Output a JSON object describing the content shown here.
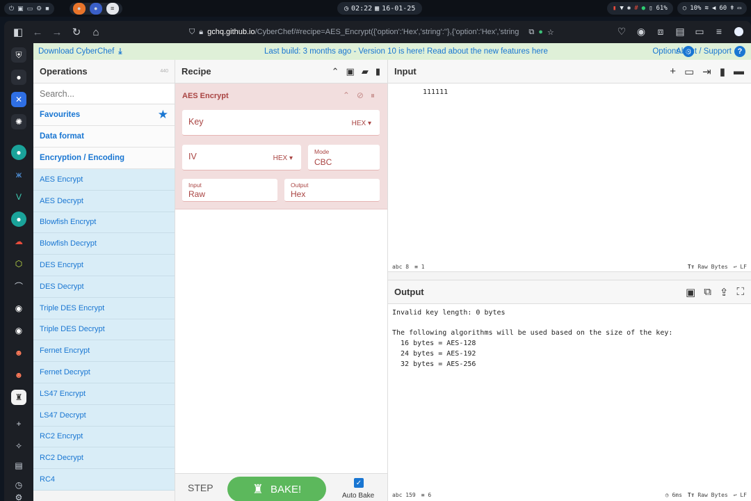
{
  "os": {
    "clock": "02:22",
    "date": "16-01-25",
    "battery": "61%",
    "cpu": "10%",
    "volume": "60"
  },
  "browser": {
    "url_host": "gchq.github.io",
    "url_path": "/CyberChef/#recipe=AES_Encrypt({'option':'Hex','string':''},{'option':'Hex','string"
  },
  "banner": {
    "download": "Download CyberChef",
    "news": "Last build: 3 months ago - Version 10 is here! Read about the new features here",
    "options": "Options",
    "about": "About / Support"
  },
  "operations": {
    "title": "Operations",
    "count": "440",
    "search_placeholder": "Search...",
    "categories": [
      "Favourites",
      "Data format",
      "Encryption / Encoding"
    ],
    "items": [
      "AES Encrypt",
      "AES Decrypt",
      "Blowfish Encrypt",
      "Blowfish Decrypt",
      "DES Encrypt",
      "DES Decrypt",
      "Triple DES Encrypt",
      "Triple DES Decrypt",
      "Fernet Encrypt",
      "Fernet Decrypt",
      "LS47 Encrypt",
      "LS47 Decrypt",
      "RC2 Encrypt",
      "RC2 Decrypt",
      "RC4"
    ]
  },
  "recipe": {
    "title": "Recipe",
    "op_title": "AES Encrypt",
    "key_label": "Key",
    "key_format": "HEX",
    "iv_label": "IV",
    "iv_format": "HEX",
    "mode_label": "Mode",
    "mode_value": "CBC",
    "input_label": "Input",
    "input_value": "Raw",
    "output_label": "Output",
    "output_value": "Hex",
    "step": "STEP",
    "bake": "BAKE!",
    "auto_bake": "Auto Bake"
  },
  "input": {
    "title": "Input",
    "value": "111111",
    "chars": "8",
    "lines": "1",
    "encoding": "Raw Bytes",
    "eol": "LF"
  },
  "output": {
    "title": "Output",
    "text": "Invalid key length: 0 bytes\n\nThe following algorithms will be used based on the size of the key:\n  16 bytes = AES-128\n  24 bytes = AES-192\n  32 bytes = AES-256",
    "chars": "159",
    "lines": "6",
    "time": "6ms",
    "encoding": "Raw Bytes",
    "eol": "LF"
  }
}
